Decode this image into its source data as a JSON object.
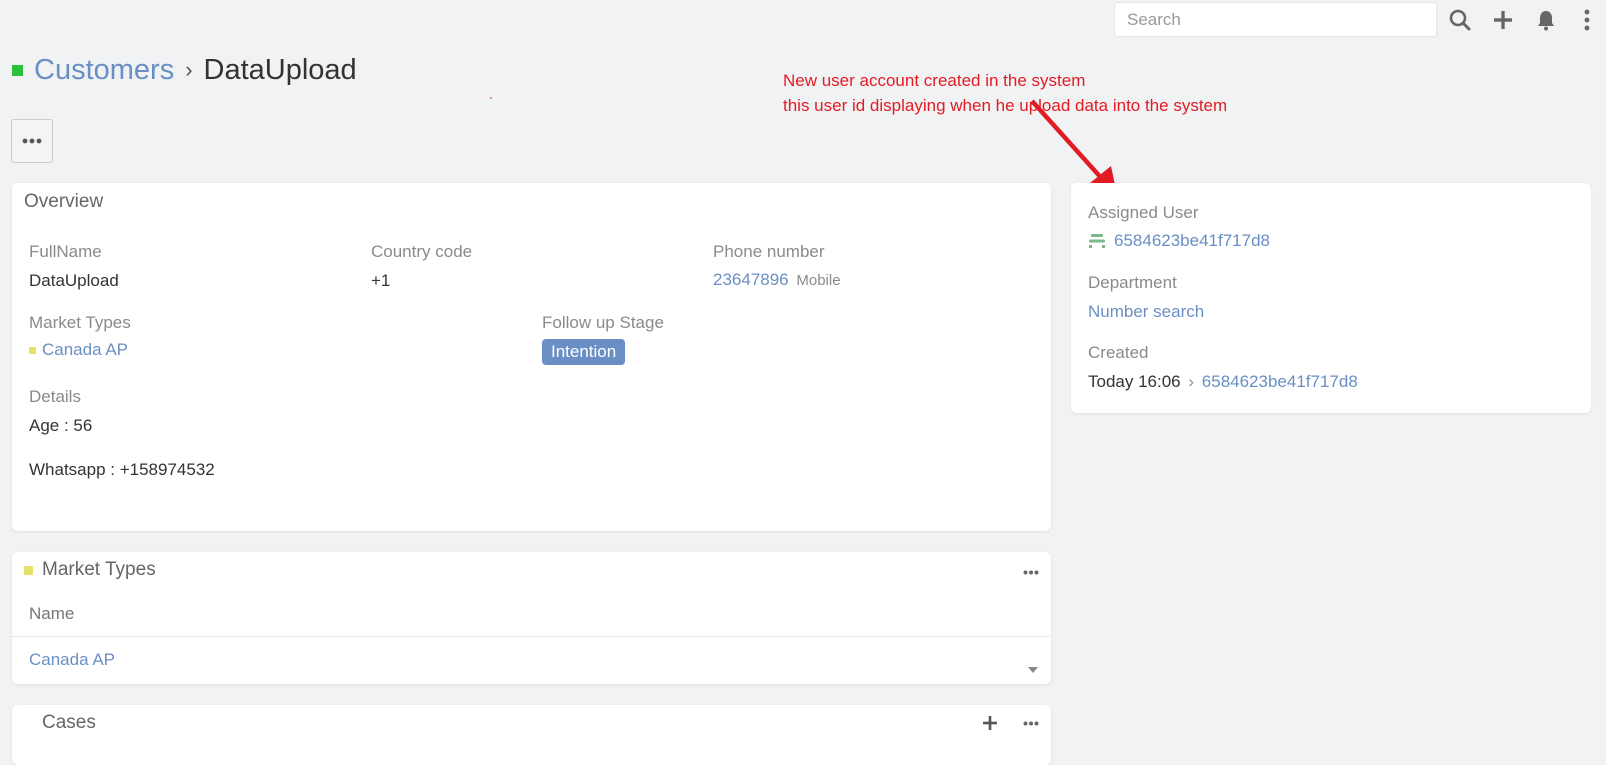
{
  "topbar": {
    "search_placeholder": "Search"
  },
  "breadcrumb": {
    "parent": "Customers",
    "separator": "›",
    "current": "DataUpload"
  },
  "annotation": {
    "line1": "New user account created in the system",
    "line2": "this user id displaying when he upload data into the system",
    "tick": "`",
    "color": "#e31b23"
  },
  "overview": {
    "title": "Overview",
    "fullname_label": "FullName",
    "fullname_value": "DataUpload",
    "country_code_label": "Country code",
    "country_code_value": "+1",
    "phone_label": "Phone number",
    "phone_value": "23647896",
    "phone_type": "Mobile",
    "market_types_label": "Market Types",
    "market_types_value": "Canada AP",
    "follow_up_label": "Follow up Stage",
    "follow_up_value": "Intention",
    "details_label": "Details",
    "details_line1": "Age : 56",
    "details_line2": "Whatsapp : +158974532"
  },
  "side": {
    "assigned_user_label": "Assigned User",
    "assigned_user_value": "6584623be41f717d8",
    "department_label": "Department",
    "department_value": "Number search",
    "created_label": "Created",
    "created_time": "Today 16:06",
    "created_sep": "›",
    "created_by": "6584623be41f717d8"
  },
  "market_panel": {
    "title": "Market Types",
    "column_name": "Name",
    "row_value": "Canada AP"
  },
  "cases_panel": {
    "title": "Cases"
  },
  "colors": {
    "accent_link": "#6a8fc5",
    "brand_green": "#2cc13b",
    "market_yellow": "#e4e26a",
    "background": "#f1f2f4"
  }
}
